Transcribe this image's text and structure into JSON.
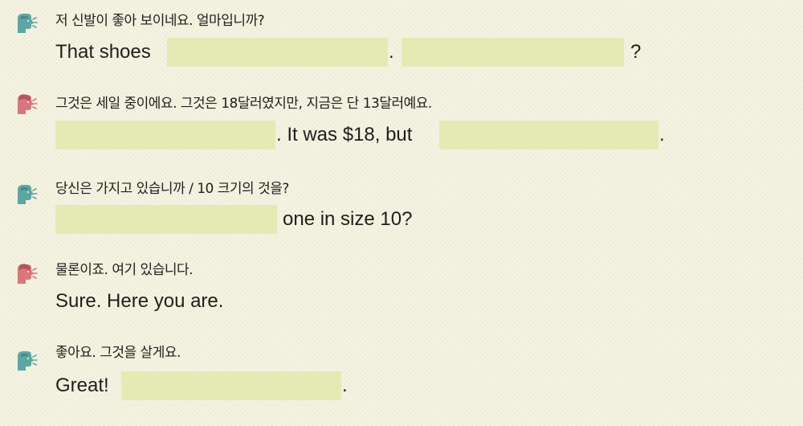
{
  "colors": {
    "background": "#f5f3e2",
    "blank_fill": "#e4eab4",
    "speaker_a": "#5ea6a2",
    "speaker_b": "#d7787c"
  },
  "dialogue": [
    {
      "speaker_icon": "teal-speaker-icon",
      "korean": "저 신발이 좋아 보이네요. 얼마입니까?",
      "english": [
        "That shoes",
        ".",
        "?"
      ]
    },
    {
      "speaker_icon": "pink-speaker-icon",
      "korean": "그것은 세일 중이에요. 그것은 18달러였지만, 지금은 단 13달러예요.",
      "english": [
        ". It was $18, but",
        "."
      ]
    },
    {
      "speaker_icon": "teal-speaker-icon",
      "korean": "당신은 가지고 있습니까 / 10 크기의 것을?",
      "english": [
        "one in size 10?"
      ]
    },
    {
      "speaker_icon": "pink-speaker-icon",
      "korean": "물론이죠. 여기 있습니다.",
      "english": [
        "Sure. Here you are."
      ]
    },
    {
      "speaker_icon": "teal-speaker-icon",
      "korean": "좋아요. 그것을 살게요.",
      "english": [
        "Great!",
        "."
      ]
    }
  ]
}
